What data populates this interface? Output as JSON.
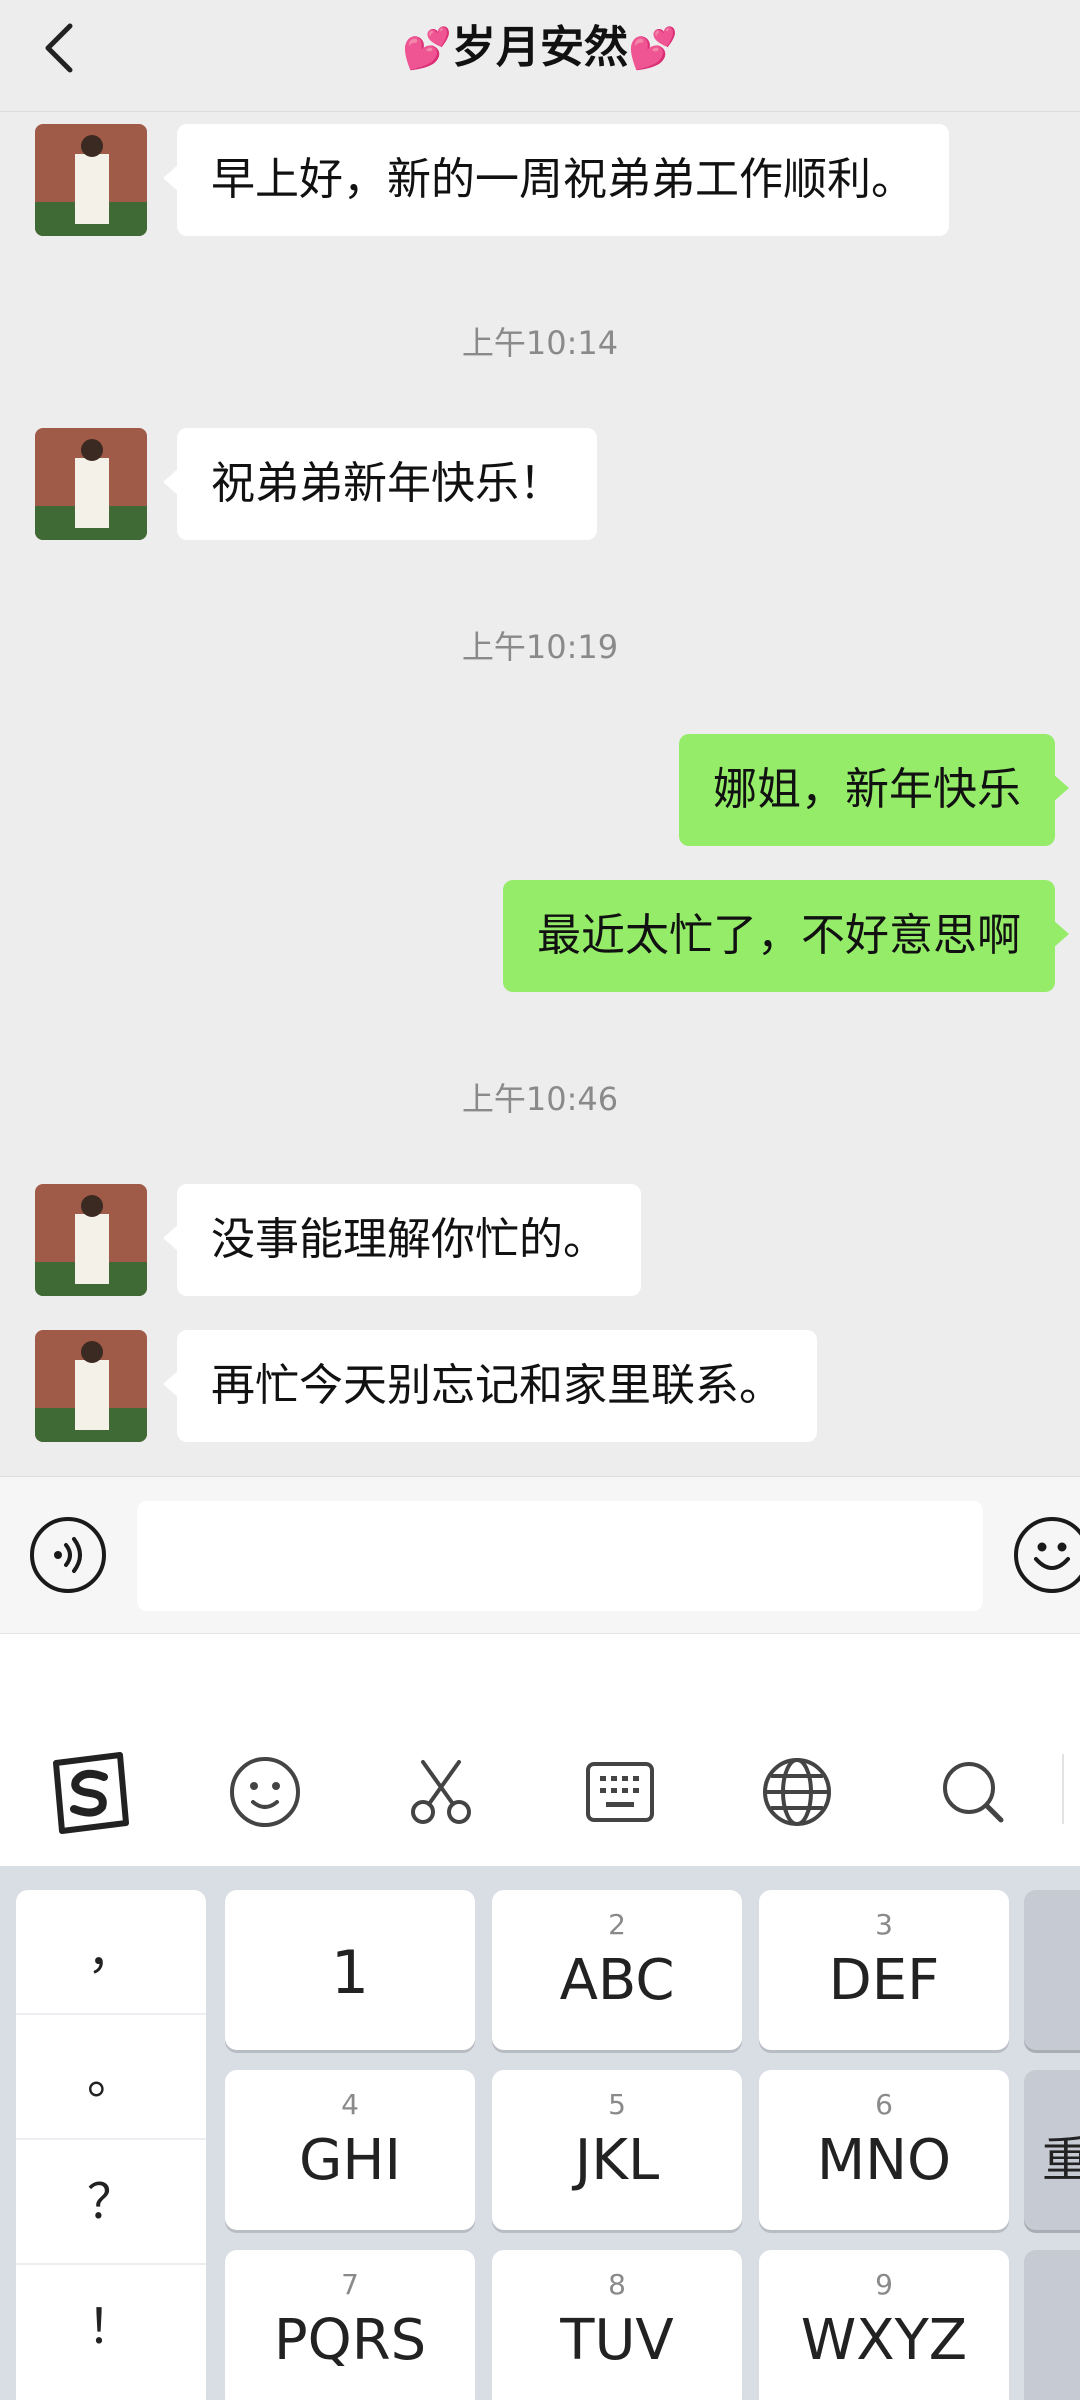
{
  "header": {
    "title": "岁月安然",
    "title_decor": "💕"
  },
  "messages": [
    {
      "type": "in",
      "text": "早上好，新的一周祝弟弟工作顺利。"
    },
    {
      "type": "time",
      "text": "上午10:14"
    },
    {
      "type": "in",
      "text": "祝弟弟新年快乐！"
    },
    {
      "type": "time",
      "text": "上午10:19"
    },
    {
      "type": "out",
      "text": "娜姐，新年快乐"
    },
    {
      "type": "out",
      "text": "最近太忙了，不好意思啊"
    },
    {
      "type": "time",
      "text": "上午10:46"
    },
    {
      "type": "in",
      "text": "没事能理解你忙的。"
    },
    {
      "type": "in",
      "text": "再忙今天别忘记和家里联系。"
    }
  ],
  "input": {
    "value": "",
    "placeholder": ""
  },
  "toolbar": {
    "icons": [
      "sogou-logo-icon",
      "emoji-icon",
      "scissors-icon",
      "keyboard-icon",
      "globe-icon",
      "search-icon"
    ]
  },
  "keyboard": {
    "punctuation": [
      "，",
      "。",
      "？",
      "！"
    ],
    "keys": [
      {
        "num": "",
        "letters": "1"
      },
      {
        "num": "2",
        "letters": "ABC"
      },
      {
        "num": "3",
        "letters": "DEF"
      },
      {
        "num": "4",
        "letters": "GHI"
      },
      {
        "num": "5",
        "letters": "JKL"
      },
      {
        "num": "6",
        "letters": "MNO"
      },
      {
        "num": "7",
        "letters": "PQRS"
      },
      {
        "num": "8",
        "letters": "TUV"
      },
      {
        "num": "9",
        "letters": "WXYZ"
      }
    ],
    "side_char": "重"
  },
  "colors": {
    "incoming_bubble": "#ffffff",
    "outgoing_bubble": "#95ec69",
    "background": "#ededed",
    "timestamp": "#8a8a8a"
  }
}
